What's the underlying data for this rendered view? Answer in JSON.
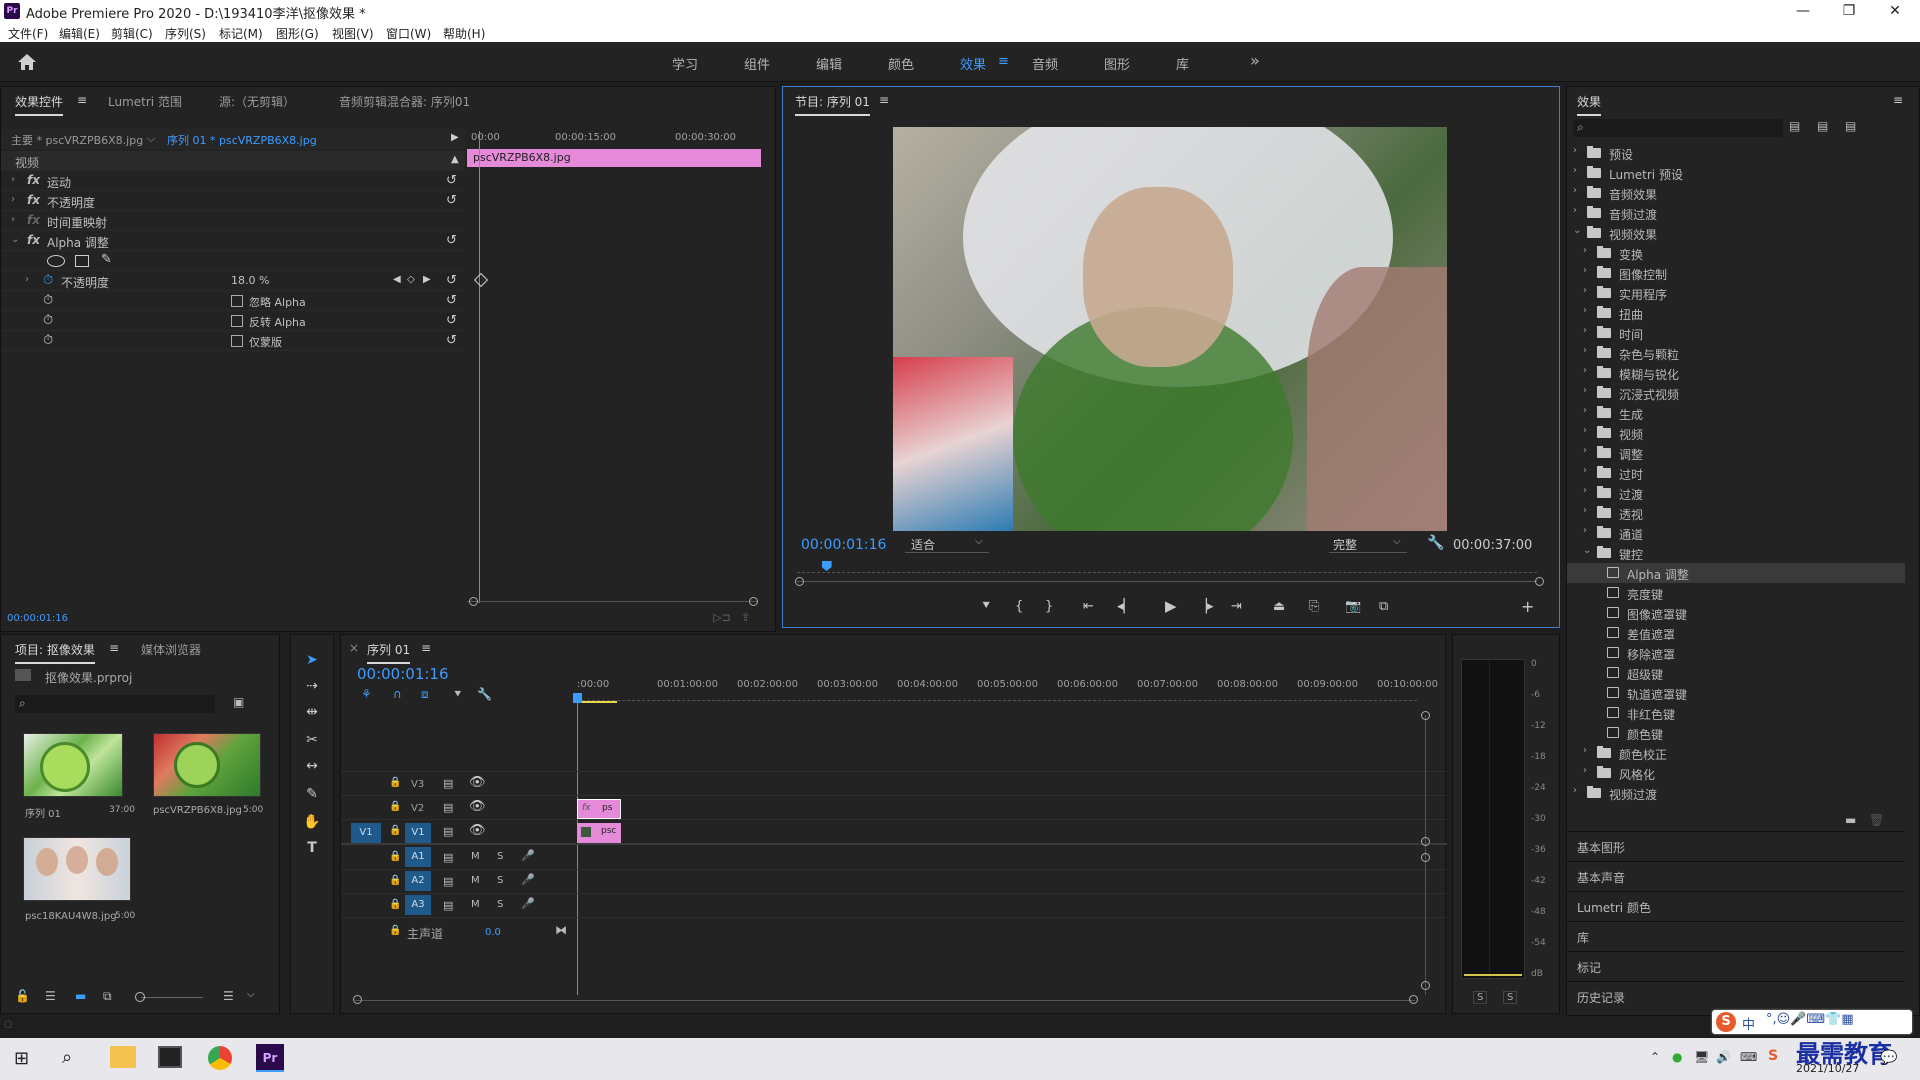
{
  "app": {
    "title": "Adobe Premiere Pro 2020 - D:\\193410李洋\\抠像效果 *",
    "logo": "Pr"
  },
  "window_controls": {
    "minimize": "—",
    "maximize": "❐",
    "close": "✕"
  },
  "menu": [
    "文件(F)",
    "编辑(E)",
    "剪辑(C)",
    "序列(S)",
    "标记(M)",
    "图形(G)",
    "视图(V)",
    "窗口(W)",
    "帮助(H)"
  ],
  "workspaces": {
    "items": [
      "学习",
      "组件",
      "编辑",
      "颜色",
      "效果",
      "音频",
      "图形",
      "库"
    ],
    "active": "效果",
    "more": "»"
  },
  "effect_controls": {
    "tabs": [
      "效果控件",
      "Lumetri 范围",
      "源:（无剪辑）",
      "音频剪辑混合器: 序列01"
    ],
    "master_label": "主要 * pscVRZPB6X8.jpg",
    "sequence_label": "序列 01 * pscVRZPB6X8.jpg",
    "ruler": [
      "00:00",
      "00:00:15:00",
      "00:00:30:00"
    ],
    "clip_name": "pscVRZPB6X8.jpg",
    "section_video": "视频",
    "effects": [
      {
        "name": "运动"
      },
      {
        "name": "不透明度"
      },
      {
        "name": "时间重映射"
      },
      {
        "name": "Alpha 调整"
      }
    ],
    "param_opacity": {
      "name": "不透明度",
      "value": "18.0 %"
    },
    "checkboxes": [
      "忽略 Alpha",
      "反转 Alpha",
      "仅蒙版"
    ],
    "timecode": "00:00:01:16"
  },
  "program_monitor": {
    "title": "节目: 序列 01",
    "timecode": "00:00:01:16",
    "zoom": "适合",
    "quality": "完整",
    "duration": "00:00:37:00",
    "playhead_fraction": 0.04
  },
  "effects_panel": {
    "title": "效果",
    "search_placeholder": "",
    "tree": [
      {
        "label": "预设",
        "level": 0,
        "type": "folder",
        "open": false
      },
      {
        "label": "Lumetri 预设",
        "level": 0,
        "type": "folder",
        "open": false
      },
      {
        "label": "音频效果",
        "level": 0,
        "type": "folder",
        "open": false
      },
      {
        "label": "音频过渡",
        "level": 0,
        "type": "folder",
        "open": false
      },
      {
        "label": "视频效果",
        "level": 0,
        "type": "folder",
        "open": true
      },
      {
        "label": "变换",
        "level": 1,
        "type": "folder",
        "open": false
      },
      {
        "label": "图像控制",
        "level": 1,
        "type": "folder",
        "open": false
      },
      {
        "label": "实用程序",
        "level": 1,
        "type": "folder",
        "open": false
      },
      {
        "label": "扭曲",
        "level": 1,
        "type": "folder",
        "open": false
      },
      {
        "label": "时间",
        "level": 1,
        "type": "folder",
        "open": false
      },
      {
        "label": "杂色与颗粒",
        "level": 1,
        "type": "folder",
        "open": false
      },
      {
        "label": "模糊与锐化",
        "level": 1,
        "type": "folder",
        "open": false
      },
      {
        "label": "沉浸式视频",
        "level": 1,
        "type": "folder",
        "open": false
      },
      {
        "label": "生成",
        "level": 1,
        "type": "folder",
        "open": false
      },
      {
        "label": "视频",
        "level": 1,
        "type": "folder",
        "open": false
      },
      {
        "label": "调整",
        "level": 1,
        "type": "folder",
        "open": false
      },
      {
        "label": "过时",
        "level": 1,
        "type": "folder",
        "open": false
      },
      {
        "label": "过渡",
        "level": 1,
        "type": "folder",
        "open": false
      },
      {
        "label": "透视",
        "level": 1,
        "type": "folder",
        "open": false
      },
      {
        "label": "通道",
        "level": 1,
        "type": "folder",
        "open": false
      },
      {
        "label": "键控",
        "level": 1,
        "type": "folder",
        "open": true
      },
      {
        "label": "Alpha 调整",
        "level": 2,
        "type": "preset",
        "selected": true
      },
      {
        "label": "亮度键",
        "level": 2,
        "type": "preset"
      },
      {
        "label": "图像遮罩键",
        "level": 2,
        "type": "preset"
      },
      {
        "label": "差值遮罩",
        "level": 2,
        "type": "preset"
      },
      {
        "label": "移除遮罩",
        "level": 2,
        "type": "preset"
      },
      {
        "label": "超级键",
        "level": 2,
        "type": "preset"
      },
      {
        "label": "轨道遮罩键",
        "level": 2,
        "type": "preset"
      },
      {
        "label": "非红色键",
        "level": 2,
        "type": "preset"
      },
      {
        "label": "颜色键",
        "level": 2,
        "type": "preset"
      },
      {
        "label": "颜色校正",
        "level": 1,
        "type": "folder",
        "open": false
      },
      {
        "label": "风格化",
        "level": 1,
        "type": "folder",
        "open": false
      },
      {
        "label": "视频过渡",
        "level": 0,
        "type": "folder",
        "open": false
      }
    ],
    "collapsed_panels": [
      "基本图形",
      "基本声音",
      "Lumetri 颜色",
      "库",
      "标记",
      "历史记录"
    ]
  },
  "project_panel": {
    "tabs": [
      "项目: 抠像效果",
      "媒体浏览器"
    ],
    "project_file": "抠像效果.prproj",
    "items": [
      {
        "name": "序列 01",
        "duration": "37:00"
      },
      {
        "name": "pscVRZPB6X8.jpg",
        "duration": "5:00"
      },
      {
        "name": "psc18KAU4W8.jpg",
        "duration": "5:00"
      }
    ]
  },
  "timeline": {
    "tab": "序列 01",
    "timecode": "00:00:01:16",
    "ruler": [
      ":00:00",
      "00:01:00:00",
      "00:02:00:00",
      "00:03:00:00",
      "00:04:00:00",
      "00:05:00:00",
      "00:06:00:00",
      "00:07:00:00",
      "00:08:00:00",
      "00:09:00:00",
      "00:10:00:00"
    ],
    "video_tracks": [
      "V3",
      "V2",
      "V1"
    ],
    "audio_tracks": [
      "A1",
      "A2",
      "A3"
    ],
    "source_patch": "V1",
    "mute_label": "M",
    "solo_label": "S",
    "master_label": "主声道",
    "master_value": "0.0",
    "clip_v2": {
      "fx": "fx",
      "name": "ps"
    },
    "clip_v1": {
      "name": "psc"
    }
  },
  "audio_meter": {
    "scale": [
      "0",
      "-6",
      "-12",
      "-18",
      "-24",
      "-30",
      "-36",
      "-42",
      "-48",
      "-54",
      "dB"
    ],
    "solo_left": "S",
    "solo_right": "S"
  },
  "taskbar": {
    "date": "2021/10/27",
    "ime": "中",
    "watermark": "最需教育"
  },
  "colors": {
    "accent": "#3d9cff",
    "clip_pink": "#e589d9",
    "track_blue": "#1f5a8a",
    "panel_bg": "#232323"
  }
}
